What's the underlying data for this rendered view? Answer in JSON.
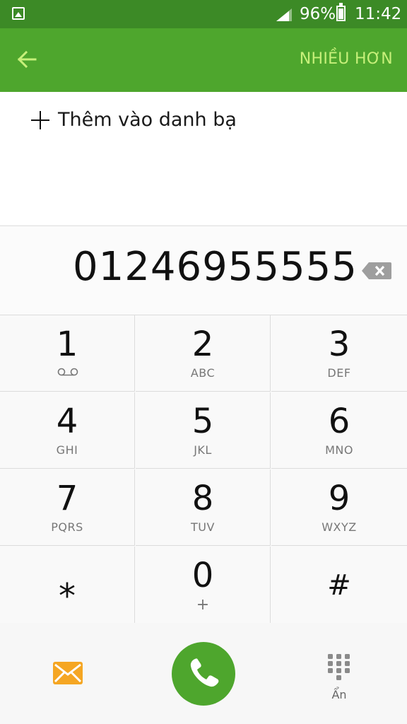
{
  "status": {
    "battery_percent": "96%",
    "time": "11:42",
    "icons": [
      "gallery-icon",
      "signal-icon",
      "battery-icon"
    ]
  },
  "appbar": {
    "back_icon": "arrow-left-icon",
    "more_label": "NHIỀU HƠN"
  },
  "contact": {
    "add_label": "Thêm vào danh bạ"
  },
  "dialer": {
    "number": "01246955555",
    "keys": [
      {
        "digit": "1",
        "letters": ""
      },
      {
        "digit": "2",
        "letters": "ABC"
      },
      {
        "digit": "3",
        "letters": "DEF"
      },
      {
        "digit": "4",
        "letters": "GHI"
      },
      {
        "digit": "5",
        "letters": "JKL"
      },
      {
        "digit": "6",
        "letters": "MNO"
      },
      {
        "digit": "7",
        "letters": "PQRS"
      },
      {
        "digit": "8",
        "letters": "TUV"
      },
      {
        "digit": "9",
        "letters": "WXYZ"
      },
      {
        "digit": "⁎",
        "letters": ""
      },
      {
        "digit": "0",
        "letters": "+"
      },
      {
        "digit": "#",
        "letters": ""
      }
    ]
  },
  "bottom": {
    "hide_label": "Ẩn"
  },
  "colors": {
    "status_bar": "#3c8a26",
    "app_bar": "#4ea62d",
    "accent_text": "#c7f07a",
    "call_button": "#4ea62d",
    "message_icon": "#f5a623"
  }
}
